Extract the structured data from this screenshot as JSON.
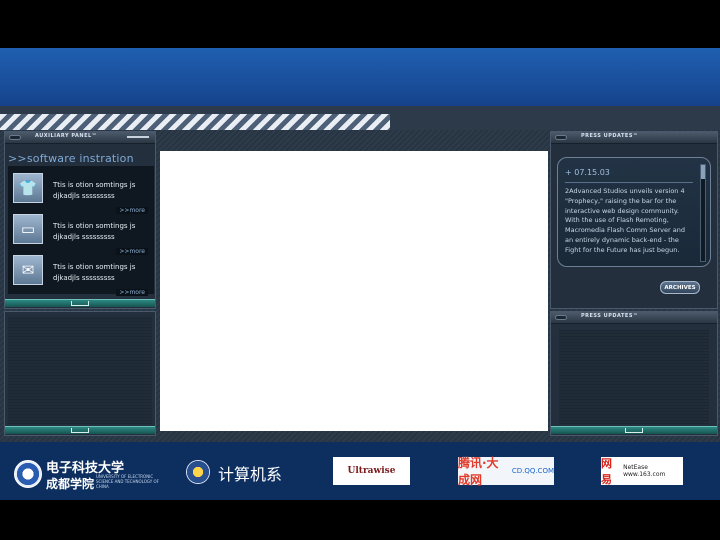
{
  "aux_panel": {
    "title": "AUXILIARY PANEL™",
    "header": ">>software instration",
    "items": [
      {
        "icon": "tshirt-icon",
        "glyph": "👕",
        "text": "Ttis is otion somtings js djkadjls sssssssss",
        "more": ">>more"
      },
      {
        "icon": "display-icon",
        "glyph": "▭",
        "text": "Ttis is otion somtings js djkadjls sssssssss",
        "more": ">>more"
      },
      {
        "icon": "envelope-icon",
        "glyph": "✉",
        "text": "Ttis is otion somtings js djkadjls sssssssss",
        "more": ">>more"
      }
    ]
  },
  "press_panel": {
    "title": "PRESS UPDATES™",
    "date": "+ 07.15.03",
    "body": "2Advanced Studios unveils version 4 \"Prophecy,\" raising the bar for the interactive web design community. With the use of Flash Remoting, Macromedia Flash Comm Server and an entirely dynamic back-end - the Fight for the Future has just begun.",
    "archives_label": "ARCHIVES"
  },
  "press_panel_2": {
    "title": "PRESS UPDATES™"
  },
  "footer": {
    "school_cn": "电子科技大学",
    "school_cn2": "成都学院",
    "school_en": "UNIVERSITY OF ELECTRONIC SCIENCE AND TECHNOLOGY OF CHINA",
    "department": "计算机系",
    "sponsor_1": "Ultrawise",
    "sponsor_2a": "腾讯·大成网",
    "sponsor_2b": "CD.QQ.COM",
    "sponsor_3a": "网易",
    "sponsor_3b": "NetEase www.163.com"
  }
}
